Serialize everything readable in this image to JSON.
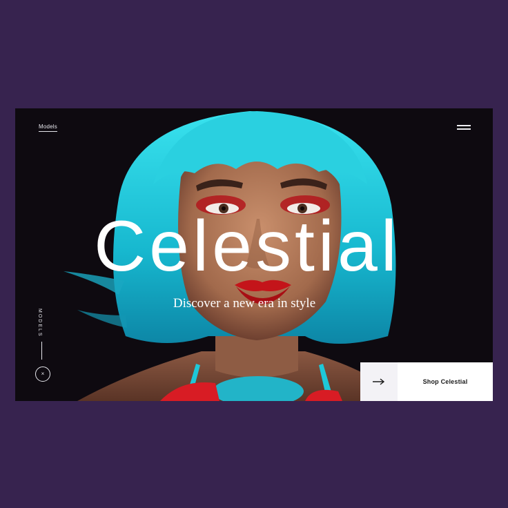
{
  "nav": {
    "brand": "Models",
    "menu_icon": "hamburger-icon"
  },
  "hero": {
    "title": "Celestial",
    "tagline": "Discover a new era in style",
    "side_label": "MODELS",
    "close_glyph": "×",
    "image_subject": "portrait-photo"
  },
  "cta": {
    "label": "Shop Celestial",
    "icon": "arrow-right-icon"
  },
  "colors": {
    "page_background": "#37234f",
    "frame_background": "#0e0a10",
    "hair": "#1ec8d8",
    "lips": "#c4141a",
    "skin": "#b07a5a",
    "button_background": "#ffffff"
  }
}
